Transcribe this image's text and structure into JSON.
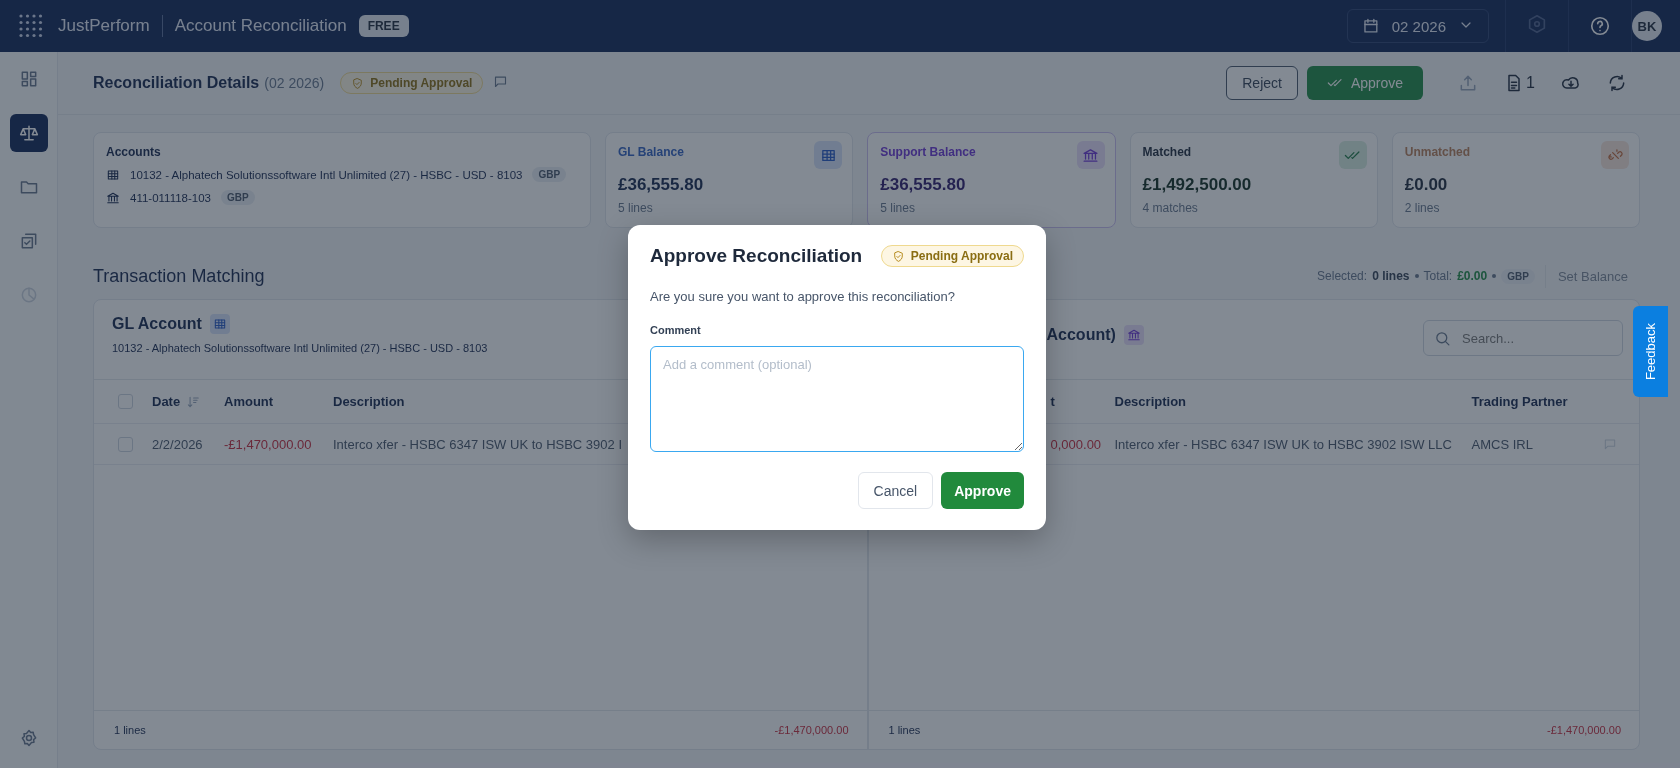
{
  "app": {
    "brand": "JustPerform",
    "title": "Account Reconciliation",
    "plan_badge": "FREE"
  },
  "period_picker": {
    "value": "02 2026"
  },
  "user": {
    "initials": "BK"
  },
  "sidebar": {
    "items": [
      {
        "kind": "dashboard",
        "selected": false,
        "disabled": false
      },
      {
        "kind": "scale",
        "selected": true,
        "disabled": false
      },
      {
        "kind": "folder",
        "selected": false,
        "disabled": false
      },
      {
        "kind": "tasks",
        "selected": false,
        "disabled": false
      },
      {
        "kind": "chart",
        "selected": false,
        "disabled": true
      }
    ]
  },
  "header": {
    "title": "Reconciliation Details",
    "period": "(02 2026)",
    "status": "Pending Approval",
    "actions": [
      {
        "kind": "reject",
        "label": "Reject"
      },
      {
        "kind": "approve",
        "label": "Approve"
      },
      {
        "kind": "upload",
        "disabled": true
      },
      {
        "kind": "documents",
        "count": "1"
      },
      {
        "kind": "download"
      },
      {
        "kind": "refresh"
      }
    ]
  },
  "summary": {
    "accounts": {
      "label": "Accounts",
      "items": [
        {
          "kind": "gl",
          "name": "10132 - Alphatech Solutionssoftware Intl Unlimited (27) - HSBC - USD - 8103",
          "currency": "GBP"
        },
        {
          "kind": "bank",
          "name": "411-011118-103",
          "currency": "GBP"
        }
      ]
    },
    "cards": [
      {
        "kind": "gl",
        "label": "GL Balance",
        "value": "£36,555.80",
        "sub": "5 lines"
      },
      {
        "kind": "support",
        "label": "Support Balance",
        "value": "£36,555.80",
        "sub": "5 lines"
      },
      {
        "kind": "matched",
        "label": "Matched",
        "value": "£1,492,500.00",
        "sub": "4 matches"
      },
      {
        "kind": "unmatched",
        "label": "Unmatched",
        "value": "£0.00",
        "sub": "2 lines"
      }
    ]
  },
  "matching": {
    "title": "Transaction Matching",
    "selected_label": "Selected:",
    "selected_value": "0 lines",
    "total_label": "Total:",
    "total_value": "£0.00",
    "currency": "GBP",
    "set_balance": {
      "label": "Set Balance",
      "disabled": true
    }
  },
  "gl_panel": {
    "title": "GL Account",
    "select_all_checked": false,
    "subtitle": "10132 - Alphatech Solutionssoftware Intl Unlimited (27) - HSBC - USD - 8103",
    "columns": [
      {
        "label": "Date",
        "sorted": true
      },
      {
        "label": "Amount",
        "sorted": false
      },
      {
        "label": "Description",
        "sorted": false
      }
    ],
    "rows": [
      {
        "checked": false,
        "date": "2/2/2026",
        "amount": "-£1,470,000.00",
        "description": "Interco xfer - HSBC 6347 ISW UK to HSBC 3902 I"
      }
    ],
    "footer_count": "1 lines",
    "footer_total": "-£1,470,000.00"
  },
  "support_panel": {
    "title": "Account)",
    "search_placeholder": "Search...",
    "columns": [
      "t",
      "Description",
      "Trading Partner"
    ],
    "rows": [
      {
        "amount": "0,000.00",
        "description": "Interco xfer - HSBC 6347 ISW UK to HSBC 3902 ISW LLC",
        "partner": "AMCS IRL"
      }
    ],
    "footer_count": "1 lines",
    "footer_total": "-£1,470,000.00"
  },
  "dialog": {
    "title": "Approve Reconciliation",
    "status": "Pending Approval",
    "message": "Are you sure you want to approve this reconciliation?",
    "comment_label": "Comment",
    "comment_placeholder": "Add a comment (optional)",
    "buttons": [
      {
        "kind": "secondary",
        "label": "Cancel"
      },
      {
        "kind": "primary",
        "label": "Approve"
      }
    ]
  },
  "feedback": {
    "label": "Feedback"
  }
}
